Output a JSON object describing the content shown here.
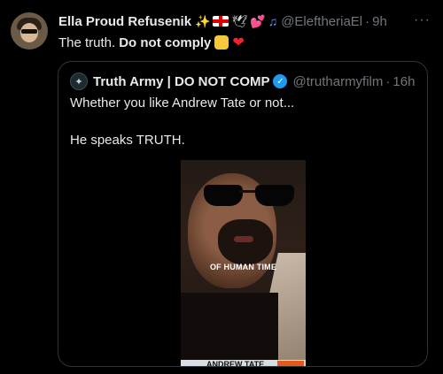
{
  "tweet": {
    "author_name": "Ella Proud Refusenik",
    "author_handle": "@EleftheriaEl",
    "time": "9h",
    "text_plain": "The truth.",
    "text_bold": "Do not comply",
    "more_label": "···",
    "name_emojis": [
      "sparkles-emoji",
      "england-flag-emoji",
      "dove-emoji",
      "hearts-emoji",
      "music-notes-emoji"
    ]
  },
  "quoted": {
    "author_name": "Truth Army | DO NOT COMP",
    "author_handle": "@trutharmyfilm",
    "time": "16h",
    "line1": "Whether you like Andrew Tate or not...",
    "line2": "He speaks TRUTH.",
    "video": {
      "caption": "OF HUMAN TIME",
      "lower_third": "ANDREW TATE"
    }
  },
  "colors": {
    "background": "#000000",
    "text": "#e7e9ea",
    "muted": "#71767b",
    "border": "#2f3336",
    "verified": "#1d9bf0",
    "heart": "#f4212e"
  }
}
